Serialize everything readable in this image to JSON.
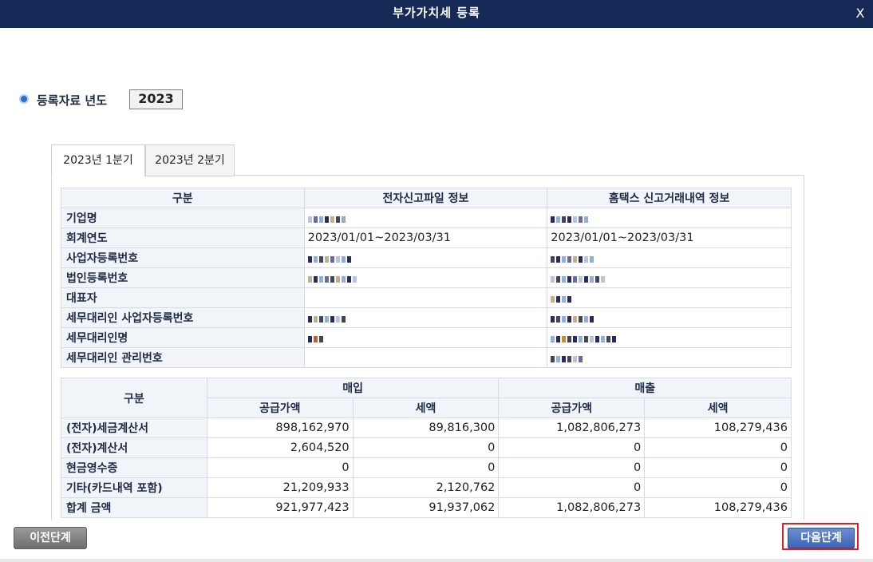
{
  "window": {
    "title": "부가가치세 등록",
    "close_label": "X"
  },
  "year_section": {
    "label": "등록자료 년도",
    "year": "2023"
  },
  "tabs": [
    {
      "label": "2023년 1분기",
      "active": true
    },
    {
      "label": "2023년 2분기",
      "active": false
    }
  ],
  "info_table": {
    "headers": [
      "구분",
      "전자신고파일 정보",
      "홈택스 신고거래내역 정보"
    ],
    "rows": [
      {
        "label": "기업명",
        "file": "",
        "hometax": ""
      },
      {
        "label": "회계연도",
        "file": "2023/01/01~2023/03/31",
        "hometax": "2023/01/01~2023/03/31"
      },
      {
        "label": "사업자등록번호",
        "file": "",
        "hometax": ""
      },
      {
        "label": "법인등록번호",
        "file": "",
        "hometax": ""
      },
      {
        "label": "대표자",
        "file": "",
        "hometax": ""
      },
      {
        "label": "세무대리인 사업자등록번호",
        "file": "",
        "hometax": ""
      },
      {
        "label": "세무대리인명",
        "file": "",
        "hometax": ""
      },
      {
        "label": "세무대리인 관리번호",
        "file": "",
        "hometax": ""
      }
    ]
  },
  "amount_table": {
    "header_category": "구분",
    "group_purchase": "매입",
    "group_sales": "매출",
    "sub_supply": "공급가액",
    "sub_tax": "세액",
    "rows": [
      {
        "label": "(전자)세금계산서",
        "p_supply": "898,162,970",
        "p_tax": "89,816,300",
        "s_supply": "1,082,806,273",
        "s_tax": "108,279,436"
      },
      {
        "label": "(전자)계산서",
        "p_supply": "2,604,520",
        "p_tax": "0",
        "s_supply": "0",
        "s_tax": "0"
      },
      {
        "label": "현금영수증",
        "p_supply": "0",
        "p_tax": "0",
        "s_supply": "0",
        "s_tax": "0"
      },
      {
        "label": "기타(카드내역 포함)",
        "p_supply": "21,209,933",
        "p_tax": "2,120,762",
        "s_supply": "0",
        "s_tax": "0"
      },
      {
        "label": "합계 금액",
        "p_supply": "921,977,423",
        "p_tax": "91,937,062",
        "s_supply": "1,082,806,273",
        "s_tax": "108,279,436"
      }
    ]
  },
  "buttons": {
    "prev": "이전단계",
    "next": "다음단계"
  },
  "colors": {
    "titlebar": "#152a57",
    "header_bg": "#f1f4f9",
    "next_button": "#4a70c2",
    "highlight": "#e02020"
  }
}
